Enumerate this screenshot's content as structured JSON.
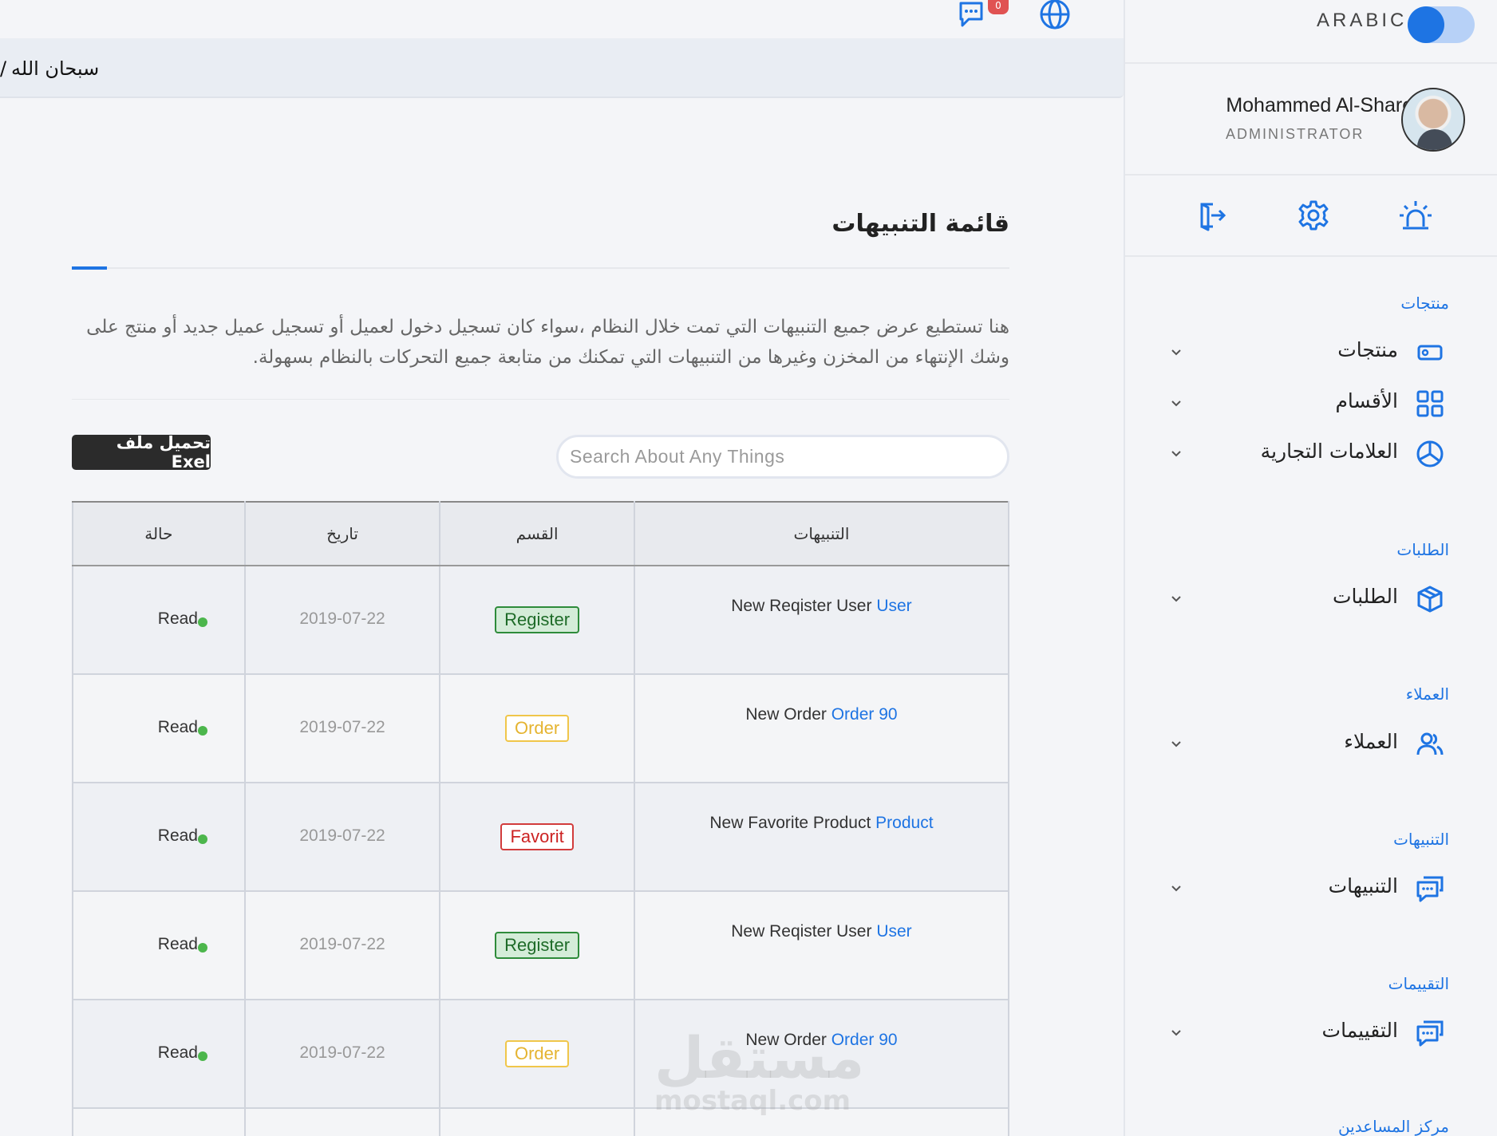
{
  "header": {
    "notification_count": "0",
    "breadcrumb": "سبحان الله",
    "breadcrumb_sep": "/"
  },
  "page": {
    "title": "قائمة التنبيهات",
    "description": "هنا تستطيع عرض جميع التنبيهات التي تمت خلال النظام ،سواء كان تسجيل دخول لعميل أو تسجيل عميل جديد أو منتج على وشك الإنتهاء من المخزن وغيرها من التنبيهات التي تمكنك من متابعة جميع التحركات بالنظام بسهولة.",
    "excel_button": "تحميل ملف Exel",
    "search_placeholder": "Search About Any Things"
  },
  "table": {
    "headers": {
      "notifications": "التنبيهات",
      "category": "القسم",
      "date": "تاريخ",
      "status": "حالة"
    },
    "rows": [
      {
        "text": "New Reqister User",
        "link": "User",
        "category": "Register",
        "category_color": "green",
        "date": "2019-07-22",
        "status": "Read"
      },
      {
        "text": "New Order",
        "link": "Order 90",
        "category": "Order",
        "category_color": "yellow",
        "date": "2019-07-22",
        "status": "Read"
      },
      {
        "text": "New Favorite Product",
        "link": "Product",
        "category": "Favorit",
        "category_color": "red",
        "date": "2019-07-22",
        "status": "Read"
      },
      {
        "text": "New Reqister User",
        "link": "User",
        "category": "Register",
        "category_color": "green",
        "date": "2019-07-22",
        "status": "Read"
      },
      {
        "text": "New Order",
        "link": "Order 90",
        "category": "Order",
        "category_color": "yellow",
        "date": "2019-07-22",
        "status": "Read"
      }
    ]
  },
  "sidebar": {
    "language": "ARABIC",
    "user_name": "Mohammed Al-Shareef",
    "user_role": "ADMINISTRATOR",
    "sections": [
      {
        "title": "منتجات",
        "items": [
          "منتجات",
          "الأقسام",
          "العلامات التجارية"
        ]
      },
      {
        "title": "الطلبات",
        "items": [
          "الطلبات"
        ]
      },
      {
        "title": "العملاء",
        "items": [
          "العملاء"
        ]
      },
      {
        "title": "التنبيهات",
        "items": [
          "التنبيهات"
        ]
      },
      {
        "title": "التقييمات",
        "items": [
          "التقييمات"
        ]
      },
      {
        "title": "مركز المساعدين",
        "items": []
      }
    ]
  },
  "watermark": {
    "arabic": "مستقل",
    "latin": "mostaql.com"
  },
  "colors": {
    "accent": "#1e74e3",
    "badge_green": "#2e8b3a",
    "badge_yellow": "#f0c64a",
    "badge_red": "#d23c3c",
    "status_dot": "#4cb64c"
  }
}
